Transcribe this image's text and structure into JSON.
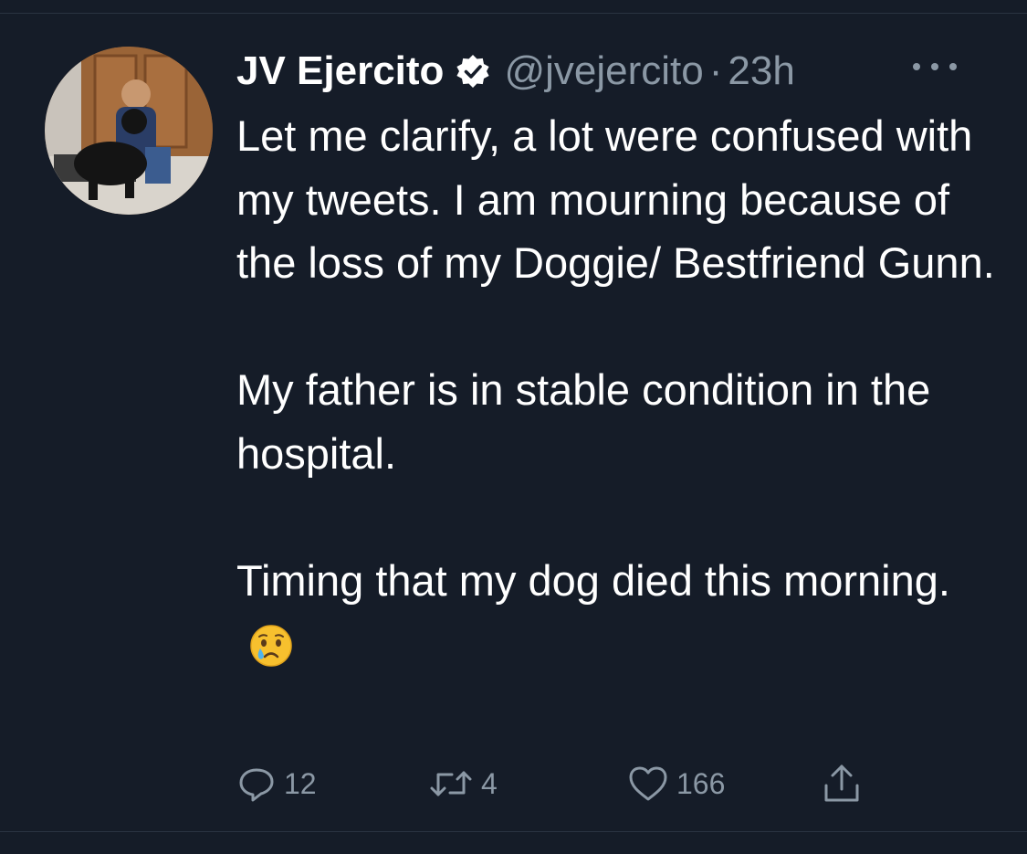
{
  "tweet": {
    "author": {
      "display_name": "JV Ejercito",
      "handle": "@jvejercito",
      "verified": true
    },
    "separator": "·",
    "time": "23h",
    "body": "Let me clarify, a lot were confused with my tweets. I am mourning because of the loss of my Doggie/ Bestfriend Gunn.\n\nMy father is in stable condition in the hospital.\n\nTiming that my dog died this morning.",
    "emoji": "crying-face",
    "counts": {
      "replies": "12",
      "retweets": "4",
      "likes": "166"
    }
  },
  "icons": {
    "verified": "verified-badge-icon",
    "more": "more-options-icon",
    "reply": "reply-icon",
    "retweet": "retweet-icon",
    "like": "heart-icon",
    "share": "share-icon"
  },
  "colors": {
    "background": "#151c28",
    "text": "#ffffff",
    "secondary_text": "#8b98a5",
    "divider": "#2a3341"
  }
}
